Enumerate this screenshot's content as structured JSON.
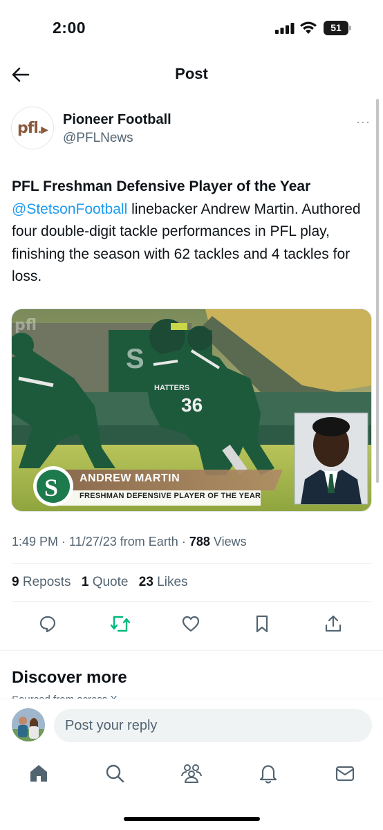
{
  "status_bar": {
    "time": "2:00",
    "battery": "51"
  },
  "header": {
    "title": "Post"
  },
  "author": {
    "avatar_text": "pfl",
    "name": "Pioneer Football",
    "handle": "@PFLNews",
    "more": "···"
  },
  "tweet": {
    "headline": "PFL Freshman Defensive Player of the Year",
    "mention": "@StetsonFootball",
    "body": " linebacker Andrew Martin. Authored four double-digit tackle performances in PFL play, finishing the season with 62 tackles and 4 tackles for loss."
  },
  "media": {
    "player_name": "ANDREW MARTIN",
    "award": "FRESHMAN DEFENSIVE PLAYER OF THE YEAR",
    "watermark": "pfl",
    "jersey_text": "HATTERS",
    "jersey_number": "36",
    "colors": {
      "green": "#1d5a3c",
      "field": "#a6b94e",
      "banner": "#8a6a4e"
    }
  },
  "meta": {
    "time": "1:49 PM",
    "date": "11/27/23",
    "source": "from Earth",
    "views_count": "788",
    "views_label": "Views"
  },
  "stats": {
    "reposts_count": "9",
    "reposts_label": "Reposts",
    "quotes_count": "1",
    "quotes_label": "Quote",
    "likes_count": "23",
    "likes_label": "Likes"
  },
  "actions": {
    "icons": [
      "reply-icon",
      "repost-icon",
      "like-icon",
      "bookmark-icon",
      "share-icon"
    ],
    "repost_color": "#00ba7c"
  },
  "discover": {
    "title": "Discover more",
    "subtitle": "Sourced from across X"
  },
  "reply": {
    "placeholder": "Post your reply"
  },
  "tab_bar": {
    "icons": [
      "home-icon",
      "search-icon",
      "communities-icon",
      "notifications-icon",
      "messages-icon"
    ]
  },
  "accent": "#1d9bf0"
}
